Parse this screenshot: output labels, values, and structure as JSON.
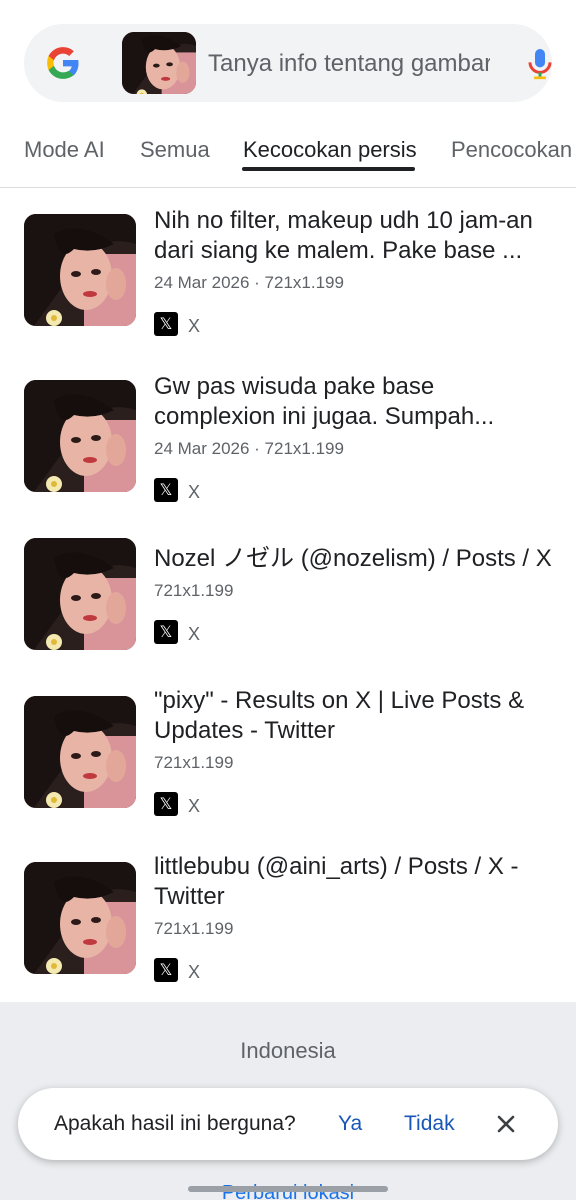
{
  "search": {
    "placeholder": "Tanya info tentang gambar",
    "query_image_icon": "photo-thumbnail"
  },
  "tabs": [
    {
      "label": "Mode AI"
    },
    {
      "label": "Semua"
    },
    {
      "label": "Kecocokan persis",
      "active": true
    },
    {
      "label": "Pencocokan s"
    }
  ],
  "results": [
    {
      "title": "Nih no filter, makeup udh 10 jam-an dari siang ke malem. Pake base ...",
      "meta": "24 Mar 2026 · 721x1.199",
      "source": "X",
      "source_icon": "x-logo-icon"
    },
    {
      "title": "Gw pas wisuda pake base complexion ini jugaa. Sumpah...",
      "meta": "24 Mar 2026 · 721x1.199",
      "source": "X",
      "source_icon": "x-logo-icon"
    },
    {
      "title": "Nozel ノゼル (@nozelism) / Posts / X",
      "meta": "721x1.199",
      "source": "X",
      "source_icon": "x-logo-icon"
    },
    {
      "title": "\"pixy\" - Results on X | Live Posts & Updates - Twitter",
      "meta": "721x1.199",
      "source": "X",
      "source_icon": "x-logo-icon"
    },
    {
      "title": "littlebubu (@aini_arts) / Posts / X - Twitter",
      "meta": "721x1.199",
      "source": "X",
      "source_icon": "x-logo-icon"
    }
  ],
  "footer": {
    "country": "Indonesia",
    "update_location": "Perbarui lokasi"
  },
  "feedback": {
    "question": "Apakah hasil ini berguna?",
    "yes": "Ya",
    "no": "Tidak"
  },
  "colors": {
    "accent": "#1a73e8",
    "text": "#202124",
    "muted": "#5f6368",
    "bar_bg": "#f1f3f4"
  }
}
